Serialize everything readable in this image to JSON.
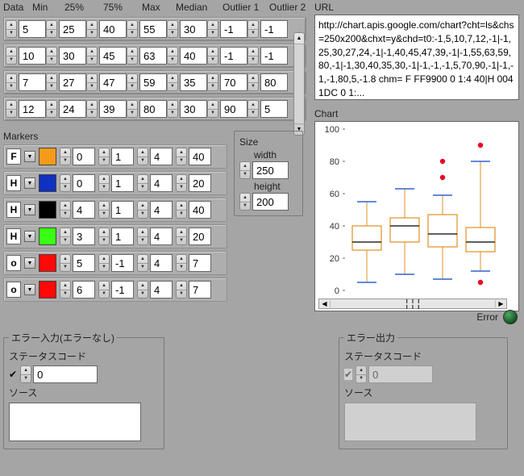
{
  "headers": [
    "Data",
    "Min",
    "25%",
    "75%",
    "Max",
    "Median",
    "Outlier 1",
    "Outlier 2"
  ],
  "data_rows": [
    [
      "5",
      "25",
      "40",
      "55",
      "30",
      "-1",
      "-1"
    ],
    [
      "10",
      "30",
      "45",
      "63",
      "40",
      "-1",
      "-1"
    ],
    [
      "7",
      "27",
      "47",
      "59",
      "35",
      "70",
      "80"
    ],
    [
      "12",
      "24",
      "39",
      "80",
      "30",
      "90",
      "5"
    ]
  ],
  "markers_label": "Markers",
  "markers": [
    {
      "t": "F",
      "color": "#f49b1a",
      "v": [
        "0",
        "1",
        "4",
        "40"
      ]
    },
    {
      "t": "H",
      "color": "#1030c0",
      "v": [
        "0",
        "1",
        "4",
        "20"
      ]
    },
    {
      "t": "H",
      "color": "#000000",
      "v": [
        "4",
        "1",
        "4",
        "40"
      ]
    },
    {
      "t": "H",
      "color": "#39ff14",
      "v": [
        "3",
        "1",
        "4",
        "20"
      ]
    },
    {
      "t": "o",
      "color": "#ff0808",
      "v": [
        "5",
        "-1",
        "4",
        "7"
      ]
    },
    {
      "t": "o",
      "color": "#ff0808",
      "v": [
        "6",
        "-1",
        "4",
        "7"
      ]
    }
  ],
  "size": {
    "label": "Size",
    "width_label": "width",
    "height_label": "height",
    "width": "250",
    "height": "200"
  },
  "url": {
    "label": "URL",
    "text": "http://chart.apis.google.com/chart?cht=ls&chs=250x200&chxt=y&chd=t0:-1,5,10,7,12,-1|-1,25,30,27,24,-1|-1,40,45,47,39,-1|-1,55,63,59,80,-1|-1,30,40,35,30,-1|-1,-1,-1,5,70,90,-1|-1,-1,-1,80,5,-1.8 chm= F FF9900 0 1:4 40|H 0041DC 0 1:..."
  },
  "chart_label": "Chart",
  "error_label": "Error",
  "err_in": {
    "title": "エラー入力(エラーなし)",
    "status": "ステータスコード",
    "value": "0",
    "src": "ソース"
  },
  "err_out": {
    "title": "エラー出力",
    "status": "ステータスコード",
    "value": "0",
    "src": "ソース"
  },
  "chart_data": {
    "type": "boxplot",
    "ylim": [
      0,
      100
    ],
    "yticks": [
      0,
      20,
      40,
      60,
      80,
      100
    ],
    "series": [
      {
        "min": 5,
        "q1": 25,
        "median": 30,
        "q3": 40,
        "max": 55,
        "outliers": []
      },
      {
        "min": 10,
        "q1": 30,
        "median": 40,
        "q3": 45,
        "max": 63,
        "outliers": []
      },
      {
        "min": 7,
        "q1": 27,
        "median": 35,
        "q3": 47,
        "max": 59,
        "outliers": [
          70,
          80
        ]
      },
      {
        "min": 12,
        "q1": 24,
        "median": 30,
        "q3": 39,
        "max": 80,
        "outliers": [
          90,
          5
        ]
      }
    ]
  }
}
